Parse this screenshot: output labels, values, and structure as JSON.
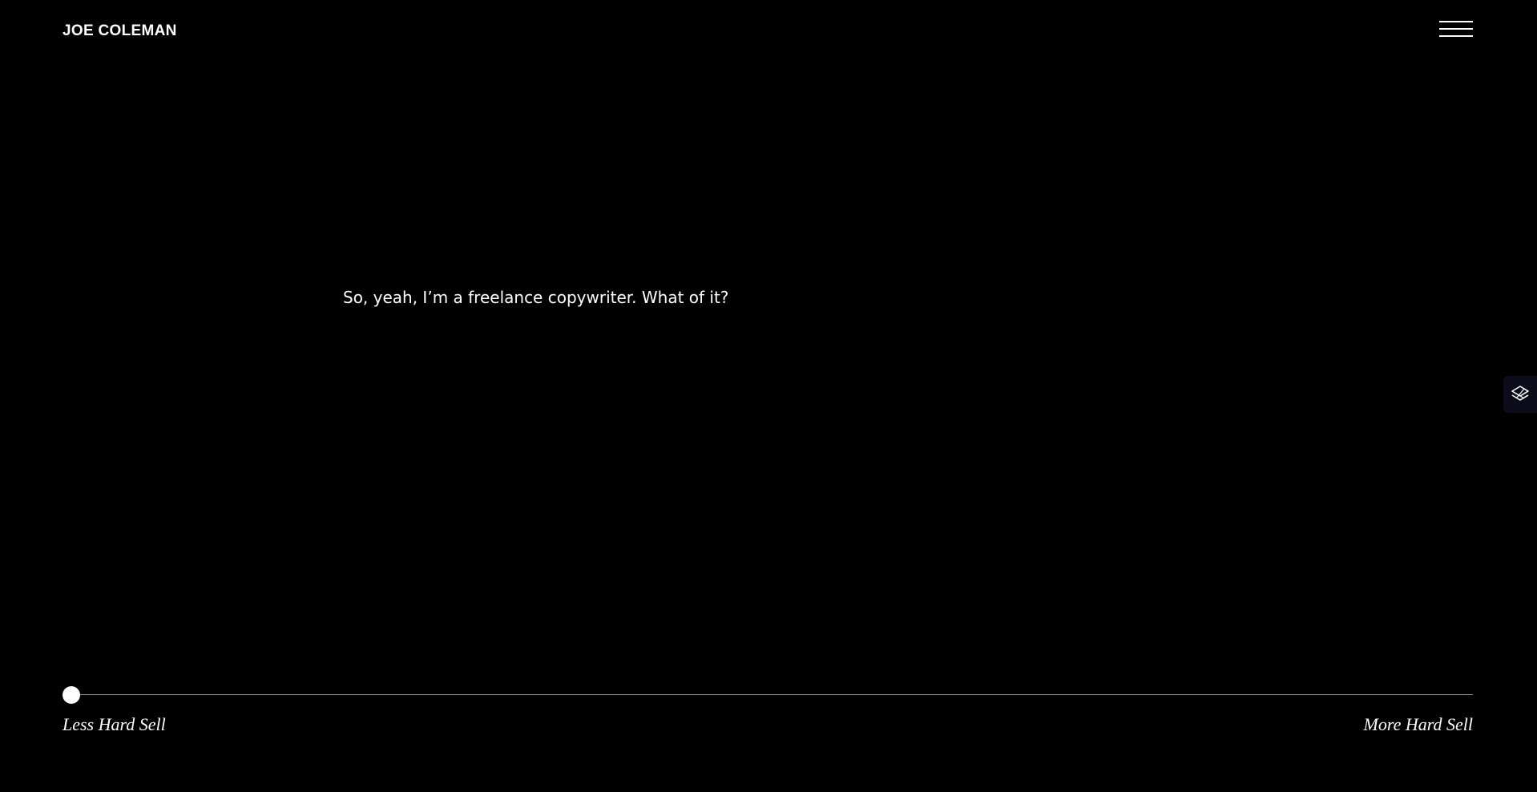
{
  "header": {
    "site_title": "JOE COLEMAN",
    "menu_icon": "hamburger-menu-icon"
  },
  "main": {
    "copy_text": "So, yeah, I’m a freelance copywriter. What of it?"
  },
  "side_widget": {
    "icon": "layers-icon"
  },
  "tone_slider": {
    "min_label": "Less Hard Sell",
    "max_label": "More Hard Sell",
    "value": 0
  },
  "colors": {
    "background": "#000000",
    "text": "#ffffff",
    "track": "#8a8a8a",
    "widget_bg": "#0b0b1a"
  }
}
